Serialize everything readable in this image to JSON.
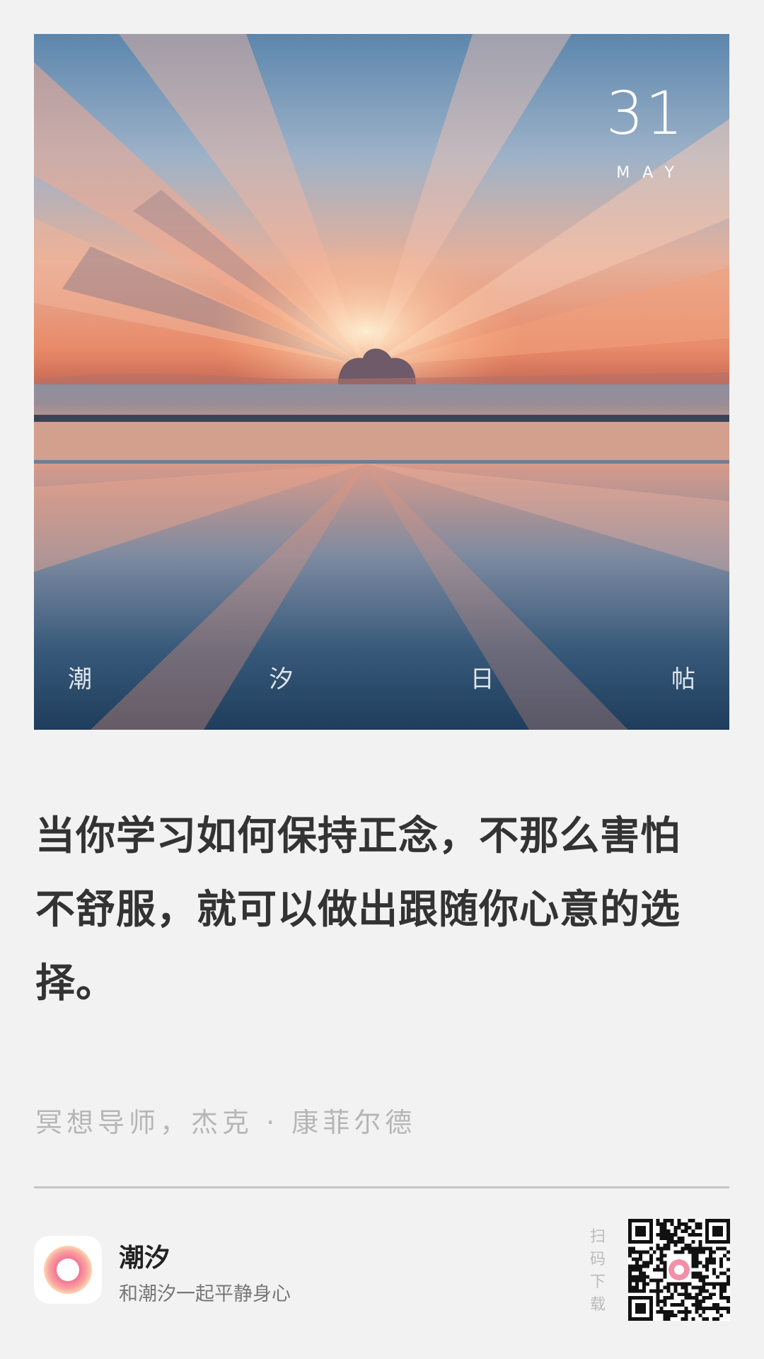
{
  "photo": {
    "date_day": "31",
    "date_month": "MAY",
    "brand_chars": [
      "潮",
      "汐",
      "日",
      "帖"
    ]
  },
  "quote": {
    "text": "当你学习如何保持正念，不那么害怕不舒服，就可以做出跟随你心意的选择。",
    "author": "冥想导师，杰克 · 康菲尔德"
  },
  "footer": {
    "app_name": "潮汐",
    "app_slogan": "和潮汐一起平静身心",
    "scan_label": "扫码下载",
    "app_icon": "tide-app-icon",
    "qr_icon": "qr-code-icon"
  },
  "colors": {
    "background": "#f2f2f2",
    "quote_text": "#333333",
    "author_text": "#b6b6b6",
    "icon_gradient_outer": "#f48fa8",
    "icon_gradient_inner": "#ffd2a8"
  }
}
